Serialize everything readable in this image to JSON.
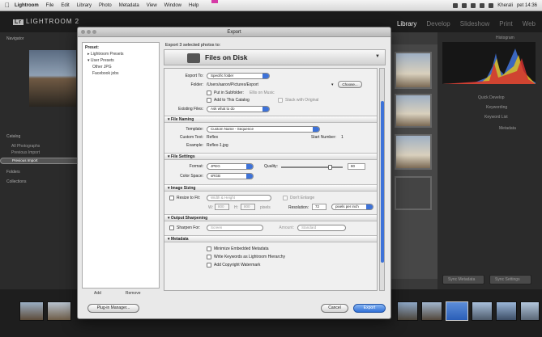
{
  "menubar": {
    "apple": "",
    "items": [
      "Lightroom",
      "File",
      "Edit",
      "Library",
      "Photo",
      "Metadata",
      "View",
      "Window",
      "Help"
    ],
    "status": "Kherali",
    "clock": "pet 14:36"
  },
  "lightroom": {
    "logo_badge": "Lr",
    "logo": "LIGHTROOM 2",
    "modules": [
      "Library",
      "Develop",
      "Slideshow",
      "Print",
      "Web"
    ],
    "left_panel": {
      "navigator": "Navigator",
      "catalog": "Catalog",
      "catalog_items": [
        "All Photographs",
        "Previous Import"
      ],
      "selected": "Previous Import",
      "folders": "Folders",
      "collections": "Collections"
    },
    "right_panel": {
      "histogram": "Histogram",
      "quick_develop": "Quick Develop",
      "keywording": "Keywording",
      "keyword_list": "Keyword List",
      "metadata": "Metadata",
      "sync_metadata": "Sync Metadata",
      "sync_settings": "Sync Settings"
    }
  },
  "dialog": {
    "title": "Export",
    "export_count": "Export 3 selected photos to:",
    "destination": "Files on Disk",
    "presets": {
      "header": "Preset:",
      "items": [
        "▸ Lightroom Presets",
        "▾ User Presets",
        "Other JPG",
        "Facebook jobs"
      ]
    },
    "add": "Add",
    "remove": "Remove",
    "export_location": {
      "export_to_label": "Export To:",
      "export_to": "Specific folder",
      "folder_label": "Folder:",
      "folder": "/Users/aaron/Pictures/Export",
      "choose": "Choose...",
      "put_in_subfolder": "Put in Subfolder:",
      "subfolder_placeholder": "Ellis on Music",
      "add_to_catalog": "Add to This Catalog",
      "stack_with_original": "Stack with Original",
      "existing_files_label": "Existing Files:",
      "existing_files": "Ask what to do"
    },
    "file_naming": {
      "header": "File Naming",
      "template_label": "Template:",
      "template": "Custom Name - Sequence",
      "custom_text_label": "Custom Text:",
      "custom_text": "Reflex",
      "start_number_label": "Start Number:",
      "start_number": "1",
      "example_label": "Example:",
      "example": "Reflex-1.jpg"
    },
    "file_settings": {
      "header": "File Settings",
      "format_label": "Format:",
      "format": "JPEG",
      "quality_label": "Quality:",
      "quality": "80",
      "quality_fraction": 0.8,
      "color_space_label": "Color Space:",
      "color_space": "sRGB"
    },
    "image_sizing": {
      "header": "Image Sizing",
      "resize_to_fit": "Resize to Fit:",
      "fit_mode": "Width & Height",
      "dont_enlarge": "Don't Enlarge",
      "w_label": "W:",
      "w": "800",
      "h_label": "H:",
      "h": "800",
      "unit": "pixels",
      "resolution_label": "Resolution:",
      "resolution": "72",
      "resolution_unit": "pixels per inch"
    },
    "output_sharpening": {
      "header": "Output Sharpening",
      "sharpen_for": "Sharpen For:",
      "sharpen_target": "Screen",
      "amount_label": "Amount:",
      "amount": "Standard"
    },
    "metadata": {
      "header": "Metadata",
      "minimize": "Minimize Embedded Metadata",
      "hierarchy": "Write Keywords as Lightroom Hierarchy",
      "watermark": "Add Copyright Watermark"
    },
    "plugin_manager": "Plug-in Manager...",
    "cancel": "Cancel",
    "export": "Export"
  }
}
